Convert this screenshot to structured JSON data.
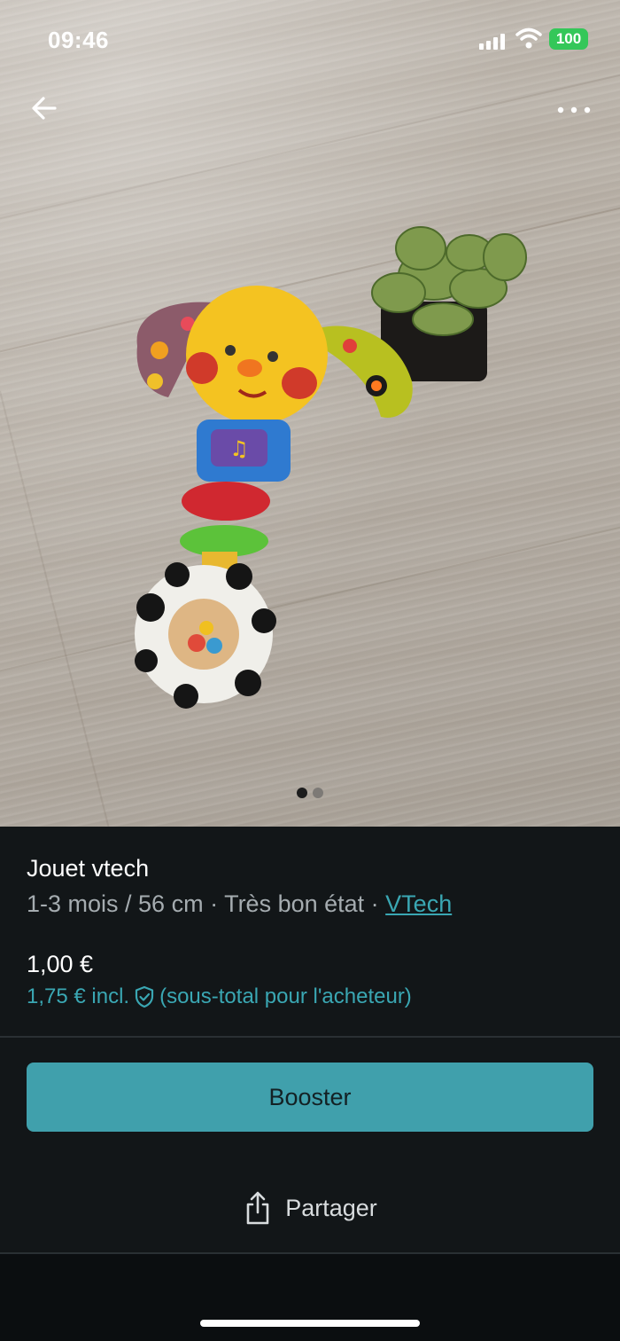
{
  "status_bar": {
    "time": "09:46",
    "battery": "100",
    "battery_color": "#34c759"
  },
  "nav": {
    "back_icon": "arrow-left-icon",
    "more_icon": "more-horizontal-icon"
  },
  "gallery": {
    "total_photos": 2,
    "active_index": 0
  },
  "listing": {
    "title": "Jouet vtech",
    "size": "1-3 mois / 56 cm",
    "separator": " · ",
    "condition": "Très bon état",
    "brand": "VTech",
    "price": "1,00 €",
    "price_incl": "1,75 € incl.",
    "price_incl_note": "(sous-total pour l'acheteur)"
  },
  "actions": {
    "booster_label": "Booster",
    "share_label": "Partager"
  },
  "colors": {
    "accent": "#40a0ac",
    "link": "#3aa7b3",
    "background": "#121618"
  }
}
